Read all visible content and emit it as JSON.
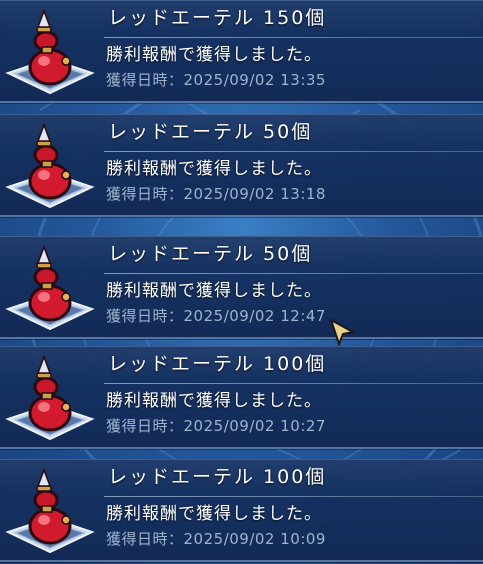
{
  "history": {
    "items": [
      {
        "title": "レッドエーテル 150個",
        "description": "勝利報酬で獲得しました。",
        "date_label": "獲得日時：",
        "date_value": "2025/09/02 13:35",
        "icon": "red-ether-potion-icon"
      },
      {
        "title": "レッドエーテル 50個",
        "description": "勝利報酬で獲得しました。",
        "date_label": "獲得日時：",
        "date_value": "2025/09/02 13:18",
        "icon": "red-ether-potion-icon"
      },
      {
        "title": "レッドエーテル 50個",
        "description": "勝利報酬で獲得しました。",
        "date_label": "獲得日時：",
        "date_value": "2025/09/02 12:47",
        "icon": "red-ether-potion-icon"
      },
      {
        "title": "レッドエーテル 100個",
        "description": "勝利報酬で獲得しました。",
        "date_label": "獲得日時：",
        "date_value": "2025/09/02 10:27",
        "icon": "red-ether-potion-icon"
      },
      {
        "title": "レッドエーテル 100個",
        "description": "勝利報酬で獲得しました。",
        "date_label": "獲得日時：",
        "date_value": "2025/09/02 10:09",
        "icon": "red-ether-potion-icon"
      }
    ]
  },
  "colors": {
    "row_background": "#173466",
    "title_text": "#ffffff",
    "date_text": "#9fb3cf",
    "potion_red": "#d21a2e",
    "potion_gold": "#c9a24a",
    "page_background": "#2a63a8"
  }
}
